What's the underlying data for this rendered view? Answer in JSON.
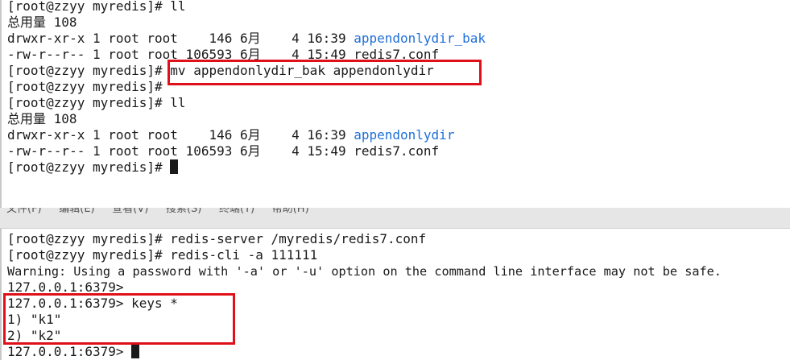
{
  "top_terminal": {
    "lines": [
      {
        "text": "[root@zzyy myredis]# ll"
      },
      {
        "text": "总用量 108"
      },
      {
        "text": "drwxr-xr-x 1 root root    146 6月    4 16:39 ",
        "dir": "appendonlydir_bak"
      },
      {
        "text": "-rw-r--r-- 1 root root 106593 6月    4 15:49 redis7.conf"
      },
      {
        "text": "[root@zzyy myredis]# mv appendonlydir_bak appendonlydir"
      },
      {
        "text": "[root@zzyy myredis]#"
      },
      {
        "text": "[root@zzyy myredis]# ll"
      },
      {
        "text": "总用量 108"
      },
      {
        "text": "drwxr-xr-x 1 root root    146 6月    4 16:39 ",
        "dir": "appendonlydir"
      },
      {
        "text": "-rw-r--r-- 1 root root 106593 6月    4 15:49 redis7.conf"
      },
      {
        "text": "[root@zzyy myredis]# "
      }
    ]
  },
  "menu_remnant": [
    "文件(F)",
    "编辑(E)",
    "查看(V)",
    "搜索(S)",
    "终端(T)",
    "帮助(H)"
  ],
  "bottom_terminal": {
    "lines": [
      {
        "text": "[root@zzyy myredis]# redis-server /myredis/redis7.conf"
      },
      {
        "text": "[root@zzyy myredis]# redis-cli -a 111111"
      },
      {
        "text": "Warning: Using a password with '-a' or '-u' option on the command line interface may not be safe."
      },
      {
        "text": "127.0.0.1:6379>"
      },
      {
        "text": "127.0.0.1:6379> keys *"
      },
      {
        "text": "1) \"k1\""
      },
      {
        "text": "2) \"k2\""
      },
      {
        "text": "127.0.0.1:6379> "
      }
    ]
  },
  "colors": {
    "highlight": "#e0101a",
    "directory": "#1e6fd9",
    "text": "#1a1a1a"
  }
}
